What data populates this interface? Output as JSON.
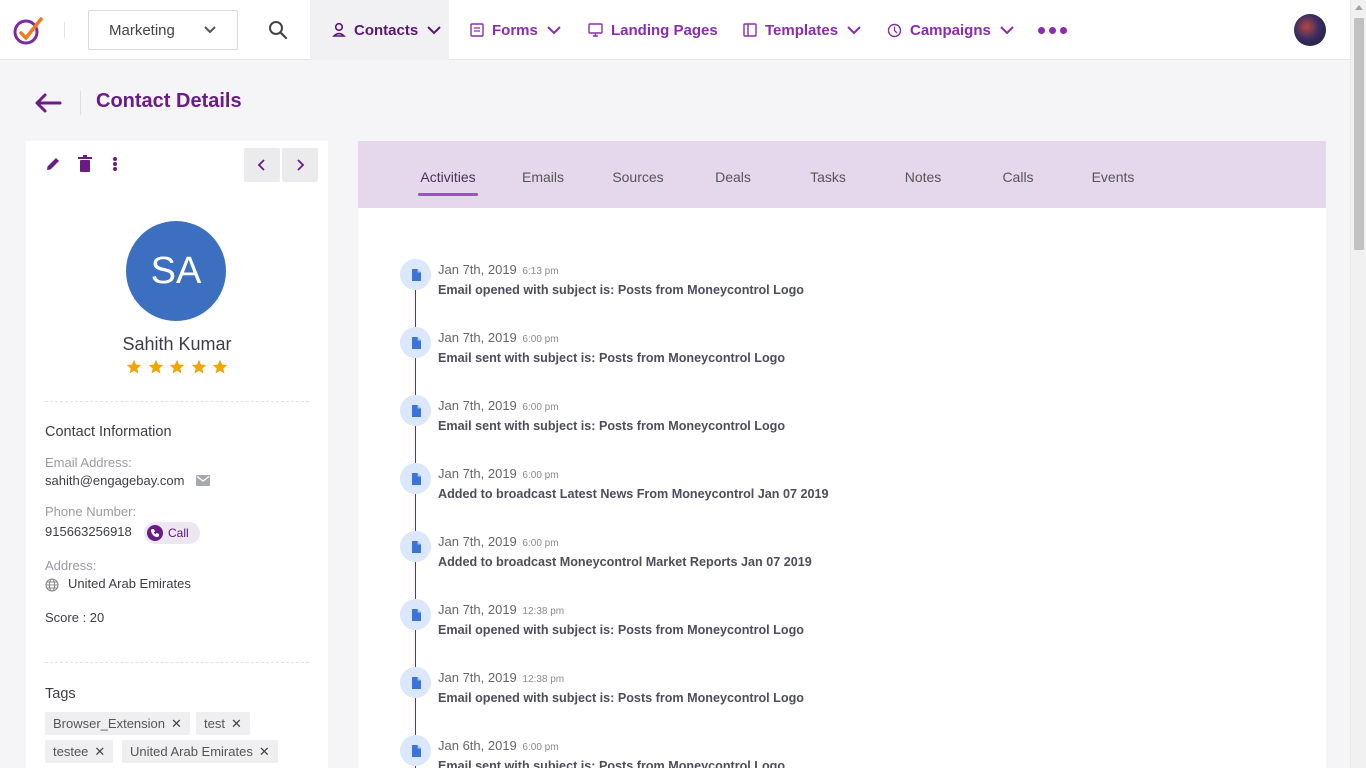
{
  "nav": {
    "product": "Marketing",
    "items": [
      {
        "label": "Contacts",
        "icon": "user-icon",
        "active": true
      },
      {
        "label": "Forms",
        "icon": "form-icon"
      },
      {
        "label": "Landing Pages",
        "icon": "monitor-icon"
      },
      {
        "label": "Templates",
        "icon": "template-icon"
      },
      {
        "label": "Campaigns",
        "icon": "campaign-icon"
      }
    ]
  },
  "page": {
    "title": "Contact Details"
  },
  "contact": {
    "initials": "SA",
    "name": "Sahith Kumar",
    "rating": 5,
    "info_heading": "Contact Information",
    "email_label": "Email Address:",
    "email": "sahith@engagebay.com",
    "phone_label": "Phone Number:",
    "phone": "915663256918",
    "call_label": "Call",
    "address_label": "Address:",
    "address": "United Arab Emirates",
    "score": "Score : 20",
    "tags_heading": "Tags",
    "tags": [
      "Browser_Extension",
      "test",
      "testee",
      "United Arab Emirates"
    ]
  },
  "tabs": [
    "Activities",
    "Emails",
    "Sources",
    "Deals",
    "Tasks",
    "Notes",
    "Calls",
    "Events"
  ],
  "activities": [
    {
      "date": "Jan 7th, 2019",
      "time": "6:13 pm",
      "text": "Email opened with subject is: Posts from Moneycontrol Logo"
    },
    {
      "date": "Jan 7th, 2019",
      "time": "6:00 pm",
      "text": "Email sent with subject is: Posts from Moneycontrol Logo"
    },
    {
      "date": "Jan 7th, 2019",
      "time": "6:00 pm",
      "text": "Email sent with subject is: Posts from Moneycontrol Logo"
    },
    {
      "date": "Jan 7th, 2019",
      "time": "6:00 pm",
      "text": "Added to broadcast Latest News From Moneycontrol Jan 07 2019"
    },
    {
      "date": "Jan 7th, 2019",
      "time": "6:00 pm",
      "text": "Added to broadcast Moneycontrol Market Reports Jan 07 2019"
    },
    {
      "date": "Jan 7th, 2019",
      "time": "12:38 pm",
      "text": "Email opened with subject is: Posts from Moneycontrol Logo"
    },
    {
      "date": "Jan 7th, 2019",
      "time": "12:38 pm",
      "text": "Email opened with subject is: Posts from Moneycontrol Logo"
    },
    {
      "date": "Jan 6th, 2019",
      "time": "6:00 pm",
      "text": "Email sent with subject is: Posts from Moneycontrol Logo"
    }
  ],
  "colors": {
    "brand": "#6a1b86",
    "accent": "#8a2bb0",
    "star": "#f0a500",
    "avatar": "#3d6fc1"
  }
}
